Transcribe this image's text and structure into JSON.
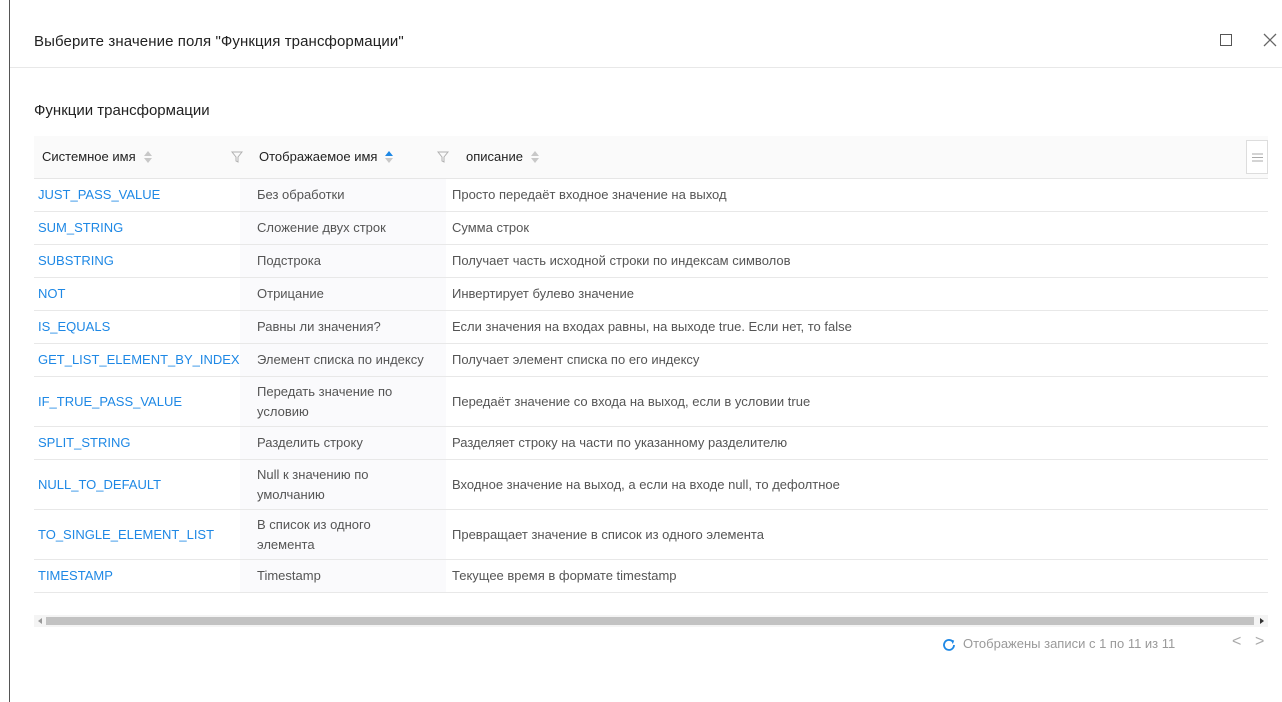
{
  "dialog": {
    "title": "Выберите значение поля \"Функция трансформации\"",
    "maximize_icon": "maximize-icon",
    "close_label": "X"
  },
  "section": {
    "title": "Функции трансформации"
  },
  "grid": {
    "columns": [
      {
        "label": "Системное имя",
        "sort": "none"
      },
      {
        "label": "Отображаемое имя",
        "sort": "asc"
      },
      {
        "label": "описание",
        "sort": "none"
      }
    ],
    "rows": [
      {
        "sys": "JUST_PASS_VALUE",
        "display": "Без обработки",
        "desc": "Просто передаёт входное значение на выход"
      },
      {
        "sys": "SUM_STRING",
        "display": "Сложение двух строк",
        "desc": "Сумма строк"
      },
      {
        "sys": "SUBSTRING",
        "display": "Подстрока",
        "desc": "Получает часть исходной строки по индексам символов"
      },
      {
        "sys": "NOT",
        "display": "Отрицание",
        "desc": "Инвертирует булево значение"
      },
      {
        "sys": "IS_EQUALS",
        "display": "Равны ли значения?",
        "desc": "Если значения на входах равны, на выходе true. Если нет, то false"
      },
      {
        "sys": "GET_LIST_ELEMENT_BY_INDEX",
        "display": "Элемент списка по индексу",
        "desc": "Получает элемент списка по его индексу"
      },
      {
        "sys": "IF_TRUE_PASS_VALUE",
        "display": "Передать значение по условию",
        "desc": "Передаёт значение со входа на выход, если в условии true"
      },
      {
        "sys": "SPLIT_STRING",
        "display": "Разделить строку",
        "desc": "Разделяет строку на части по указанному разделителю"
      },
      {
        "sys": "NULL_TO_DEFAULT",
        "display": "Null к значению по умолчанию",
        "desc": "Входное значение на выход, а если на входе null, то дефолтное"
      },
      {
        "sys": "TO_SINGLE_ELEMENT_LIST",
        "display": "В список из одного элемента",
        "desc": "Превращает значение в список из одного элемента"
      },
      {
        "sys": "TIMESTAMP",
        "display": "Timestamp",
        "desc": "Текущее время в формате timestamp"
      }
    ]
  },
  "pager": {
    "info": "Отображены записи с 1 по 11 из 11",
    "prev": "<",
    "next": ">"
  },
  "colors": {
    "link": "#1e88e5",
    "header_bg": "#fafafa",
    "border": "#e8e8e8"
  }
}
